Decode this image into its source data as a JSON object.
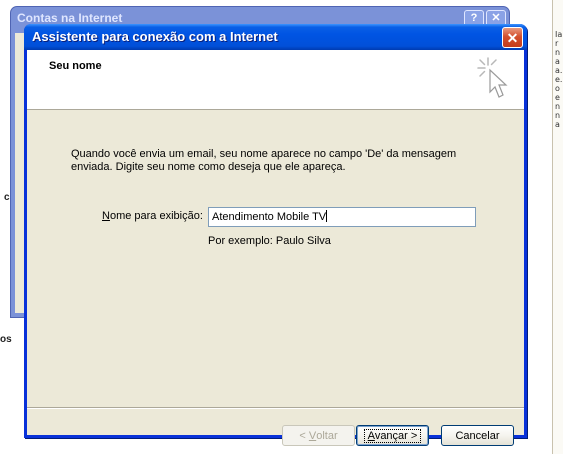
{
  "background": {
    "back_window_title": "Contas na Internet",
    "left_label_1": "c",
    "left_label_2": "os",
    "right_strip_text": "Iarnaa.e.oenna",
    "back_window_buttons": [
      "?",
      "✕"
    ]
  },
  "dialog": {
    "title": "Assistente para conexão com a Internet",
    "close_glyph": "✕",
    "header": {
      "heading": "Seu nome",
      "icon": "wizard-cursor-icon"
    },
    "description": "Quando você envia um email, seu nome aparece no campo 'De' da mensagem enviada. Digite seu nome como deseja que ele apareça.",
    "display_name_label_prefix": "N",
    "display_name_label_rest": "ome para exibição:",
    "display_name_value": "Atendimento Mobile TV",
    "example": "Por exemplo: Paulo Silva"
  },
  "buttons": {
    "back_prefix": "< ",
    "back_accel": "V",
    "back_rest": "oltar",
    "next_accel": "A",
    "next_rest": "vançar >",
    "cancel": "Cancelar"
  },
  "colors": {
    "titlebar": "#0054e3",
    "dialog_face": "#ece9d8",
    "close_button": "#d4502e"
  }
}
